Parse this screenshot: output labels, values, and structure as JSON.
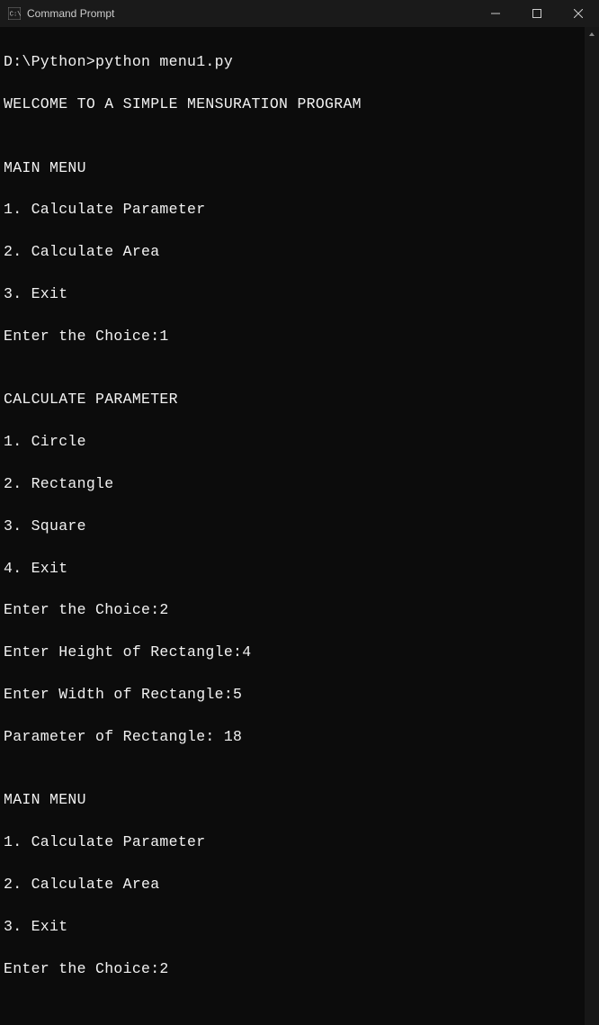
{
  "window": {
    "title": "Command Prompt"
  },
  "terminal": {
    "prompt_prefix": "D:\\Python>",
    "command": "python menu1.py",
    "lines": [
      "D:\\Python>python menu1.py",
      "WELCOME TO A SIMPLE MENSURATION PROGRAM",
      "",
      "MAIN MENU",
      "1. Calculate Parameter",
      "2. Calculate Area",
      "3. Exit",
      "Enter the Choice:1",
      "",
      "CALCULATE PARAMETER",
      "1. Circle",
      "2. Rectangle",
      "3. Square",
      "4. Exit",
      "Enter the Choice:2",
      "Enter Height of Rectangle:4",
      "Enter Width of Rectangle:5",
      "Parameter of Rectangle: 18",
      "",
      "MAIN MENU",
      "1. Calculate Parameter",
      "2. Calculate Area",
      "3. Exit",
      "Enter the Choice:2"
    ]
  }
}
